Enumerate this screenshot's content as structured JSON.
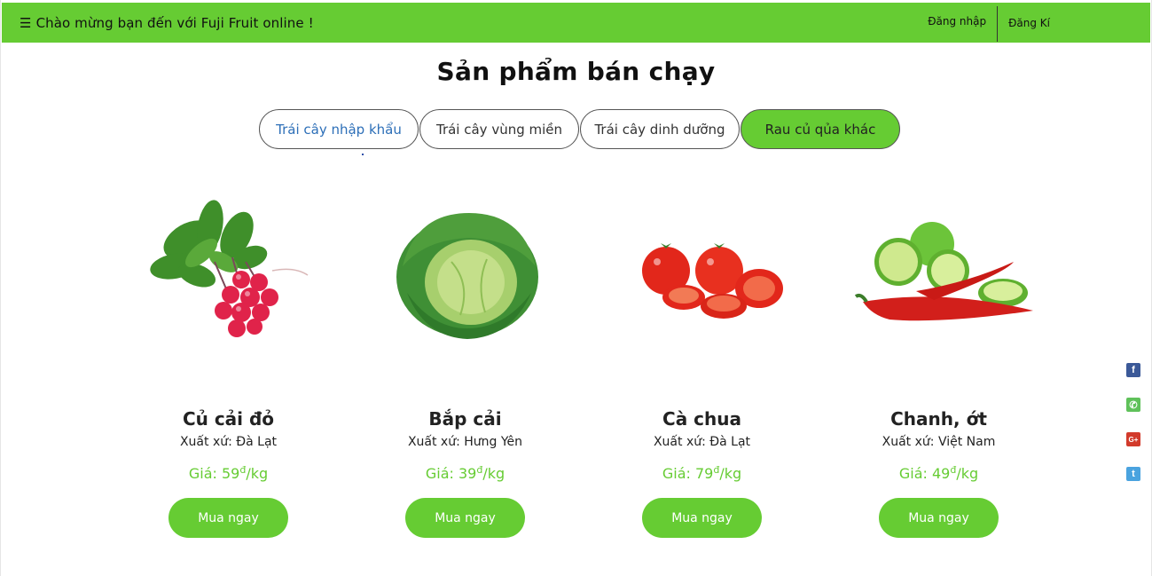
{
  "header": {
    "menu_glyph": "☰",
    "welcome": "Chào mừng bạn đến với Fuji Fruit online !",
    "login": "Đăng nhập",
    "register": "Đăng Kí"
  },
  "section": {
    "title": "Sản phẩm bán chạy"
  },
  "tabs": [
    {
      "label": "Trái cây nhập khẩu"
    },
    {
      "label": "Trái cây vùng miền"
    },
    {
      "label": "Trái cây dinh dưỡng"
    },
    {
      "label": "Rau củ qủa khác",
      "active": true
    }
  ],
  "products": [
    {
      "name": "Củ cải đỏ",
      "origin": "Xuất xứ: Đà Lạt",
      "price_prefix": "Giá: 59",
      "currency": "đ",
      "unit": "/kg",
      "buy": "Mua ngay",
      "image_icon": "radish-icon"
    },
    {
      "name": "Bắp cải",
      "origin": "Xuất xứ: Hưng Yên",
      "price_prefix": "Giá: 39",
      "currency": "đ",
      "unit": "/kg",
      "buy": "Mua ngay",
      "image_icon": "cabbage-icon"
    },
    {
      "name": "Cà chua",
      "origin": "Xuất xứ: Đà Lạt",
      "price_prefix": "Giá: 79",
      "currency": "đ",
      "unit": "/kg",
      "buy": "Mua ngay",
      "image_icon": "tomato-icon"
    },
    {
      "name": "Chanh, ớt",
      "origin": "Xuất xứ: Việt Nam",
      "price_prefix": "Giá: 49",
      "currency": "đ",
      "unit": "/kg",
      "buy": "Mua ngay",
      "image_icon": "lime-chili-icon"
    }
  ],
  "social": [
    {
      "name": "facebook-icon",
      "glyph": "f"
    },
    {
      "name": "phone-icon",
      "glyph": "✆"
    },
    {
      "name": "google-plus-icon",
      "glyph": "G+"
    },
    {
      "name": "twitter-icon",
      "glyph": "t"
    }
  ],
  "colors": {
    "accent": "#66cc33",
    "tab_link": "#2d6fb8"
  }
}
